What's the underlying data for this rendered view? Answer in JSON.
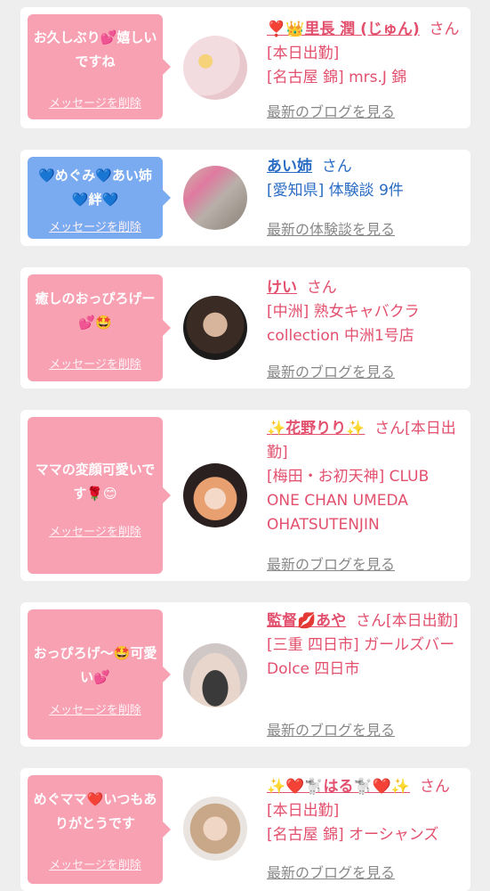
{
  "suffix": "さん",
  "delete_label": "メッセージを削除",
  "colors": {
    "pink": "#f7a1b3",
    "blue": "#7aaaf0",
    "pink_text": "#e2506e",
    "blue_text": "#2a6cc4"
  },
  "cards": [
    {
      "message": "お久しぶり💕嬉しいですね",
      "name": "❣️👑里長 潤 (じゅん)",
      "status": "[本日出勤]",
      "location": "[名古屋 錦] mrs.J 錦",
      "link": "最新のブログを見る"
    },
    {
      "message": "💙めぐみ💙あい姉💙絆💙",
      "name": "あい姉",
      "status": "",
      "location": "[愛知県] 体験談 9件",
      "link": "最新の体験談を見る"
    },
    {
      "message": "癒しのおっぴろげー💕🤩",
      "name": "けい",
      "status": "",
      "location": "[中洲] 熟女キャバクラ collection 中洲1号店",
      "link": "最新のブログを見る"
    },
    {
      "message": "ママの変顔可愛いです🌹😊",
      "name": "✨花野りり✨",
      "status": "[本日出勤]",
      "location": "[梅田・お初天神] CLUB ONE CHAN UMEDA OHATSUTENJIN",
      "link": "最新のブログを見る"
    },
    {
      "message": "おっぴろげ～🤩可愛い💕",
      "name": "監督💋あや",
      "status": "[本日出勤]",
      "location": "[三重 四日市] ガールズバー Dolce 四日市",
      "link": "最新のブログを見る"
    },
    {
      "message": "めぐママ❤️いつもありがとうです",
      "name": "✨❤️🐩はる🐩❤️✨",
      "status": "[本日出勤]",
      "location": "[名古屋 錦] オーシャンズ",
      "link": "最新のブログを見る"
    }
  ]
}
